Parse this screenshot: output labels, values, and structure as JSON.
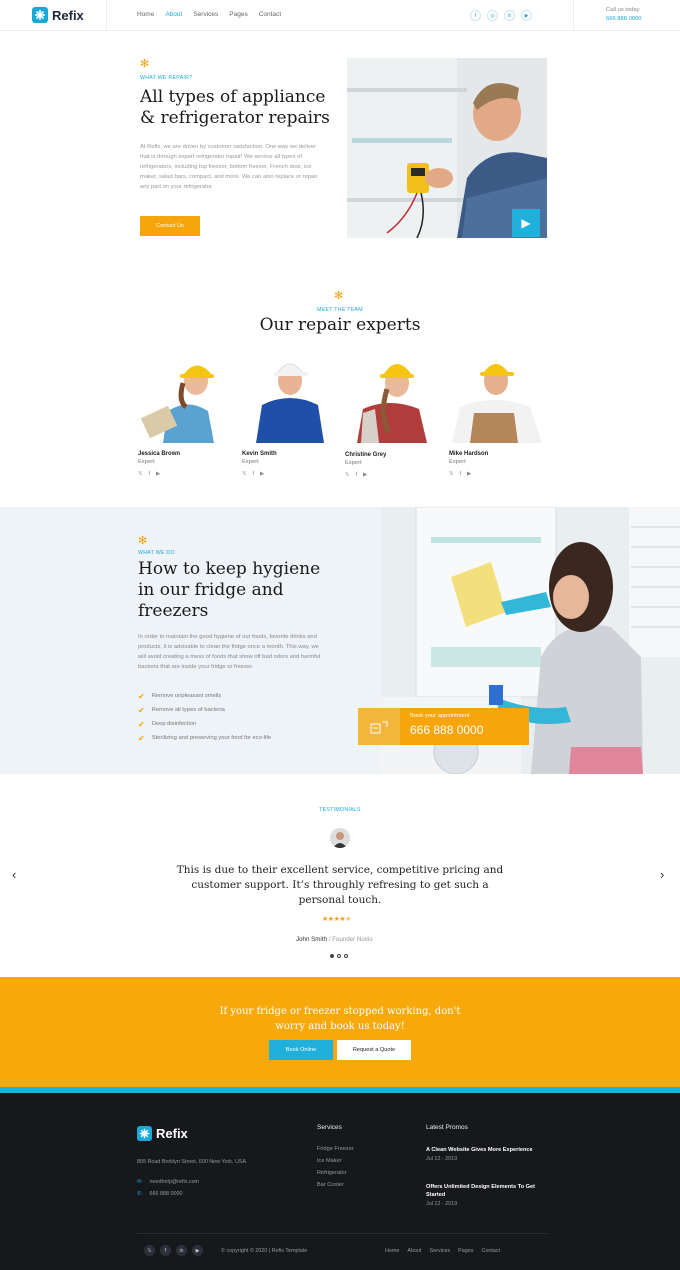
{
  "header": {
    "logo_text": "Refix",
    "nav": [
      "Home",
      "About",
      "Services",
      "Pages",
      "Contact"
    ],
    "active_nav": "About",
    "social_icons": [
      "facebook-icon",
      "instagram-icon",
      "linkedin-icon",
      "youtube-icon"
    ],
    "call_label": "Call us today",
    "call_phone": "666 888 0000"
  },
  "repair": {
    "eyebrow": "WHAT WE REPAIR?",
    "title": "All types of appliance & refrigerator repairs",
    "body": "At Refix, we are driven by customer satisfaction. One way we deliver that is through expert refrigerator repair! We service all types of refrigerators, including top freezer, bottom freezer, French door, ice maker, salad bars, compact, and more. We can also replace or repair any part on your refrigerator.",
    "button": "Contact Us"
  },
  "team": {
    "eyebrow": "MEET THE TEAM",
    "title": "Our repair experts",
    "members": [
      {
        "name": "Jessica Brown",
        "role": "Expert"
      },
      {
        "name": "Kevin Smith",
        "role": "Expert"
      },
      {
        "name": "Christine Grey",
        "role": "Expert"
      },
      {
        "name": "Mike Hardson",
        "role": "Expert"
      }
    ],
    "social_glyphs": [
      "𝕏",
      "f",
      "▶"
    ]
  },
  "hygiene": {
    "eyebrow": "WHAT WE DO",
    "title": "How to keep hygiene in our fridge and freezers",
    "body": "In order to maintain the good hygiene of our foods, favorite drinks and products, it is advisable to clean the fridge once a month. This way, we will avoid creating a mess of foods that show off bad odors and harmful bacteria that are inside your fridge or freezer.",
    "checklist": [
      "Remove unpleasant smells",
      "Remove all types of bacteria",
      "Deep disinfection",
      "Sterilizing and preserving your food for eco-life"
    ],
    "appointment_label": "Book your appointment",
    "appointment_phone": "666 888 0000"
  },
  "testimonials": {
    "eyebrow": "TESTIMONIALS",
    "quote": "This is due to their excellent service, competitive pricing and customer support. It’s throughly refresing to get such a personal touch.",
    "rating": 4.5,
    "author": "John Smith",
    "author_role": "/ Founder Novio",
    "dots": 3,
    "active_dot": 0
  },
  "cta": {
    "text": "If your fridge or freezer stopped working, don't worry and book us today!",
    "book_button": "Book Online",
    "quote_button": "Request a Quote"
  },
  "footer": {
    "logo_text": "Refix",
    "address": "855 Road Broklyn Street, 600 New York, USA",
    "email": "needhelp@refix.com",
    "phone": "666 888 0000",
    "services_title": "Services",
    "services": [
      "Fridge Freezer",
      "Ice Maker",
      "Refrigerator",
      "Bar Cooler"
    ],
    "promos_title": "Latest Promos",
    "promos": [
      {
        "title": "A Clean Website Gives More Experience",
        "date": "Jul 12 - 2019"
      },
      {
        "title": "Offers Unlimited Design Elements To Get Started",
        "date": "Jul 12 - 2019"
      }
    ],
    "copyright": "© copyright © 2020 | Refix Template",
    "nav": [
      "Home",
      "About",
      "Services",
      "Pages",
      "Contact"
    ],
    "social_icons": [
      "twitter-icon",
      "facebook-icon",
      "linkedin-icon",
      "youtube-icon"
    ]
  },
  "colors": {
    "accent": "#1aa8d8",
    "orange": "#f7a50c",
    "footer_bg": "#16181c"
  }
}
